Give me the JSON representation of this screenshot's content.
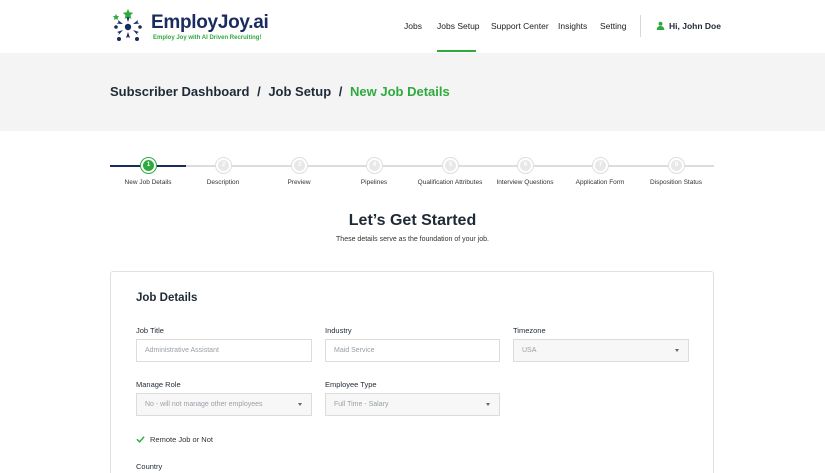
{
  "brand": {
    "name": "EmployJoy.ai",
    "tagline": "Employ Joy with AI Driven Recruiting!",
    "colors": {
      "navy": "#1a2b5e",
      "green": "#2eaa3f"
    }
  },
  "nav": {
    "items": [
      {
        "label": "Jobs"
      },
      {
        "label": "Jobs Setup",
        "active": true
      },
      {
        "label": "Support Center"
      },
      {
        "label": "Insights"
      },
      {
        "label": "Setting"
      }
    ],
    "user_greeting": "Hi, John Doe",
    "user_icon": "user-icon"
  },
  "breadcrumb": {
    "items": [
      "Subscriber Dashboard",
      "Job Setup"
    ],
    "separator": "/",
    "current": "New Job Details"
  },
  "stepper": {
    "current_step": 1,
    "steps": [
      {
        "number": "1",
        "label": "New Job Details"
      },
      {
        "number": "2",
        "label": "Description"
      },
      {
        "number": "3",
        "label": "Preview"
      },
      {
        "number": "4",
        "label": "Pipelines"
      },
      {
        "number": "5",
        "label": "Qualification Attributes"
      },
      {
        "number": "6",
        "label": "Interview Questions"
      },
      {
        "number": "7",
        "label": "Application Form"
      },
      {
        "number": "8",
        "label": "Disposition Status"
      }
    ]
  },
  "intro": {
    "title": "Let’s Get Started",
    "subtitle": "These details serve as the foundation of your job."
  },
  "form": {
    "title": "Job Details",
    "job_title": {
      "label": "Job Title",
      "placeholder": "Administrative Assistant"
    },
    "industry": {
      "label": "Industry",
      "placeholder": "Maid Service"
    },
    "timezone": {
      "label": "Timezone",
      "value": "USA"
    },
    "manage_role": {
      "label": "Manage Role",
      "value": "No - will not manage other employees"
    },
    "employee_type": {
      "label": "Employee Type",
      "value": "Full Time - Salary"
    },
    "remote": {
      "label": "Remote Job or Not",
      "checked": true
    },
    "country": {
      "label": "Country"
    }
  }
}
